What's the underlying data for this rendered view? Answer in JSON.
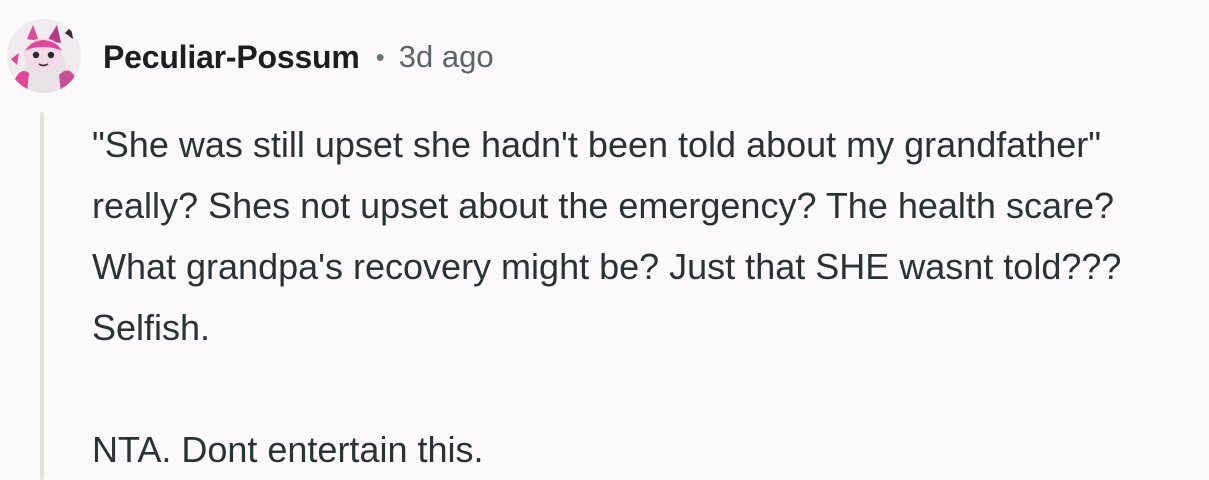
{
  "comment": {
    "author": "Peculiar-Possum",
    "separator": "•",
    "timestamp": "3d ago",
    "avatar_icon": "user-avatar-icon",
    "body": {
      "paragraphs": [
        "\"She was still upset she hadn't been told about my grandfather\" really? Shes not upset about the emergency? The health scare? What grandpa's recovery might be? Just that SHE wasnt told??? Selfish.",
        "NTA. Dont entertain this."
      ]
    }
  },
  "colors": {
    "background": "#fbf9f9",
    "text": "#2a3236",
    "muted": "#5c6469",
    "thread_line": "#e5e0dc",
    "avatar_accent": "#e0489a"
  }
}
